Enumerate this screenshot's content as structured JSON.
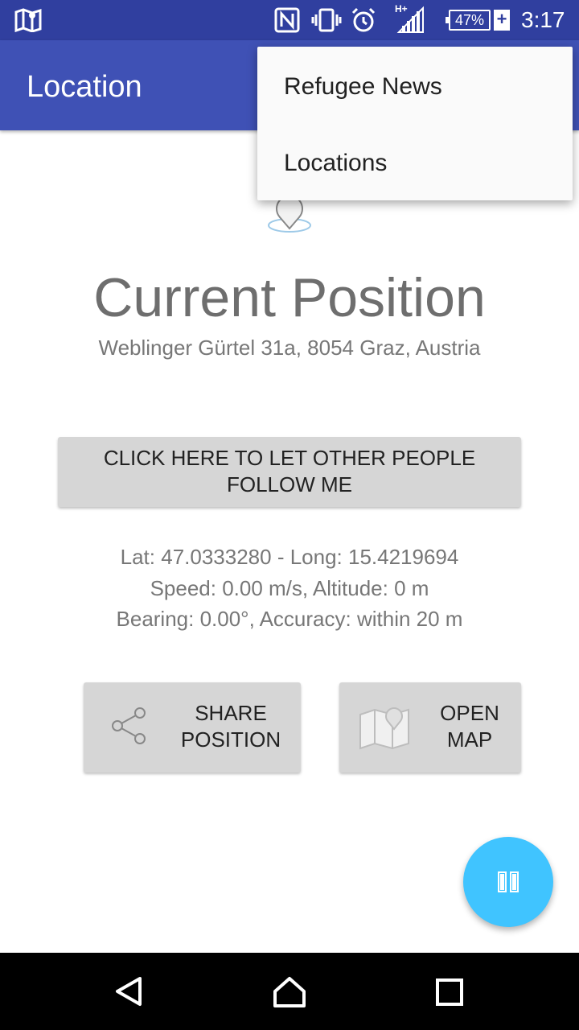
{
  "status_bar": {
    "network_type": "H+",
    "battery_percent": "47%",
    "charging": "+",
    "time": "3:17",
    "icons": [
      "map-icon",
      "nfc-icon",
      "vibrate-icon",
      "alarm-icon",
      "signal-icon",
      "battery-icon"
    ]
  },
  "app_bar": {
    "title": "Location"
  },
  "overflow_menu": {
    "items": [
      {
        "label": "Refugee News"
      },
      {
        "label": "Locations"
      }
    ]
  },
  "main": {
    "heading": "Current Position",
    "address": "Weblinger Gürtel 31a, 8054 Graz, Austria",
    "follow_button": {
      "line1": "CLICK HERE TO LET OTHER PEOPLE",
      "line2": "FOLLOW ME"
    },
    "info": {
      "coords": "Lat: 47.0333280 - Long: 15.4219694",
      "speed_altitude": "Speed: 0.00 m/s, Altitude: 0 m",
      "bearing_accuracy": "Bearing: 0.00°, Accuracy: within 20 m"
    },
    "share_button": {
      "line1": "SHARE",
      "line2": "POSITION",
      "icon": "share-icon"
    },
    "map_button": {
      "line1": "OPEN",
      "line2": "MAP",
      "icon": "map-icon"
    },
    "fab": {
      "icon": "pause-icon",
      "color": "#40c4ff"
    }
  },
  "colors": {
    "status_bar": "#303f9f",
    "app_bar": "#3f51b5",
    "button_bg": "#d6d6d6"
  },
  "nav_bar": {
    "buttons": [
      "back-icon",
      "home-icon",
      "recents-icon"
    ]
  }
}
